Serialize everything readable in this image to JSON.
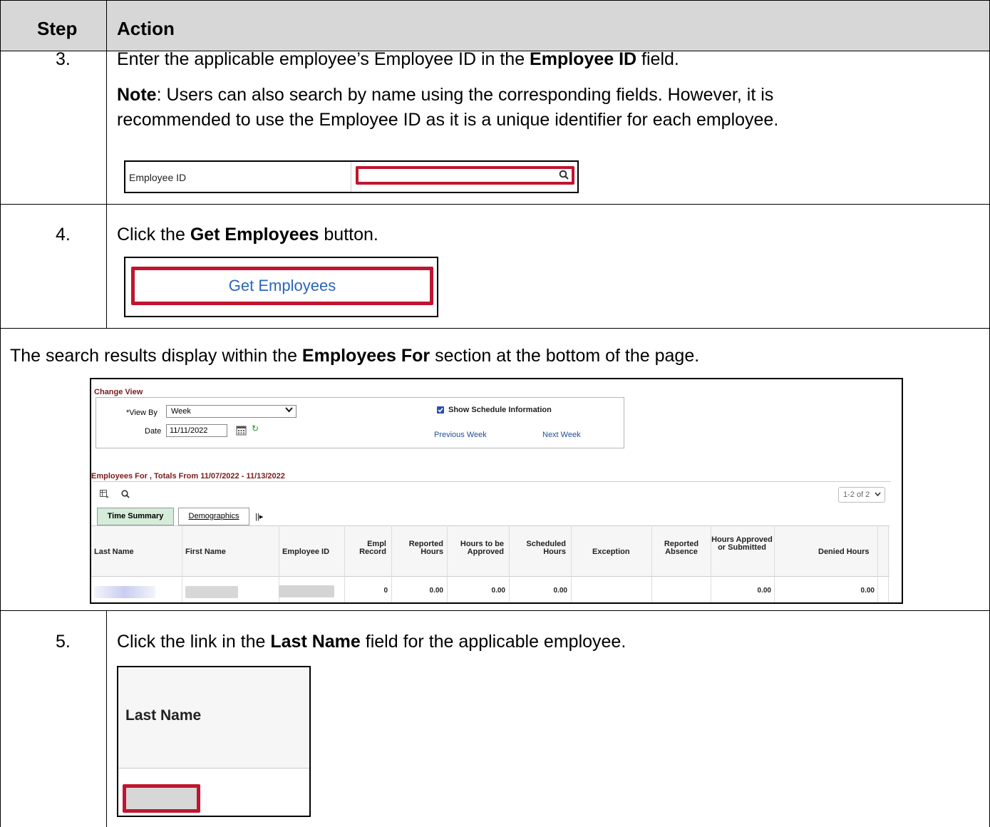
{
  "header": {
    "step": "Step",
    "action": "Action"
  },
  "step3": {
    "number": "3.",
    "line1_pre": "Enter the applicable employee’s Employee ID in the ",
    "line1_bold": "Employee ID",
    "line1_post": " field.",
    "note_bold": "Note",
    "note_line1": ": Users can also search by name using the corresponding fields. However, it is",
    "note_line2": "recommended to use the Employee ID as it is a unique identifier for each employee.",
    "field_label": "Employee ID",
    "field_value": ""
  },
  "step4": {
    "number": "4.",
    "line_pre": "Click the ",
    "line_bold": "Get Employees",
    "line_post": " button.",
    "button_label": "Get Employees"
  },
  "results": {
    "line_pre": "The search results display within the ",
    "line_bold": "Employees For",
    "line_post": " section at the bottom of the page.",
    "change_view": "Change View",
    "view_by_label": "*View By",
    "view_by_value": "Week",
    "date_label": "Date",
    "date_value": "11/11/2022",
    "show_schedule": "Show Schedule Information",
    "show_schedule_checked": true,
    "previous_week": "Previous Week",
    "next_week": "Next Week",
    "section_title": "Employees For , Totals From 11/07/2022 - 11/13/2022",
    "pagination": "1-2 of 2",
    "tabs": [
      "Time Summary",
      "Demographics"
    ],
    "columns": [
      "Last Name",
      "First Name",
      "Employee ID",
      "Empl Record",
      "Reported Hours",
      "Hours to be Approved",
      "Scheduled Hours",
      "Exception",
      "Reported Absence",
      "Hours Approved or Submitted",
      "Denied Hours"
    ],
    "row": {
      "empl_record": "0",
      "reported_hours": "0.00",
      "hours_to_approve": "0.00",
      "scheduled_hours": "0.00",
      "approved_submitted": "0.00",
      "denied_hours": "0.00"
    },
    "colors": {
      "link": "#1f4e9c",
      "title": "#7a1a1a",
      "active_tab": "#d4ecd9"
    }
  },
  "step5": {
    "number": "5.",
    "line_pre": "Click the link in the ",
    "line_bold": "Last Name",
    "line_post": " field for the applicable employee.",
    "column_label": "Last Name"
  },
  "colors": {
    "highlight": "#c0152f",
    "header_bg": "#d7d7d7"
  }
}
